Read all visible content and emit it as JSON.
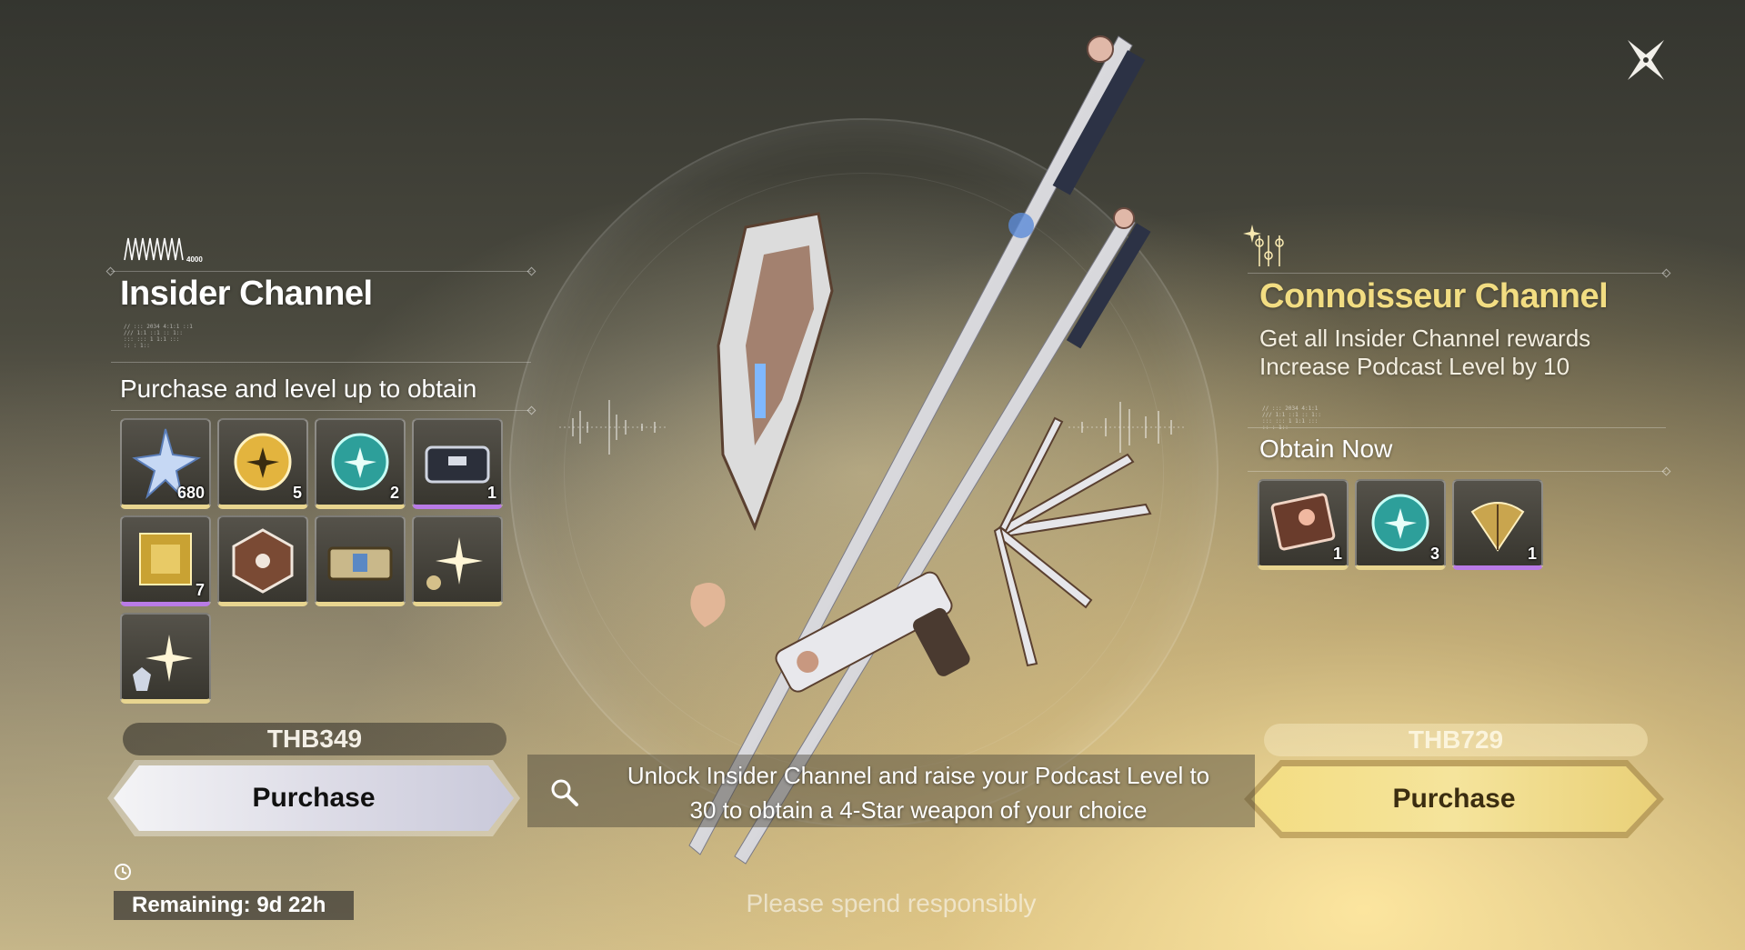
{
  "close_button": {
    "icon": "close-x-icon"
  },
  "insider": {
    "logo_caption": "4000",
    "title": "Insider Channel",
    "subtitle": "Purchase and level up to obtain",
    "items": [
      {
        "icon": "star-crystal-icon",
        "qty": "680",
        "rarity": "gold"
      },
      {
        "icon": "gold-orb-icon",
        "qty": "5",
        "rarity": "gold"
      },
      {
        "icon": "teal-orb-icon",
        "qty": "2",
        "rarity": "gold"
      },
      {
        "icon": "supply-case-icon",
        "qty": "1",
        "rarity": "purple"
      },
      {
        "icon": "gold-cube-icon",
        "qty": "7",
        "rarity": "purple"
      },
      {
        "icon": "dice-icon",
        "qty": "",
        "rarity": "gold"
      },
      {
        "icon": "chest-icon",
        "qty": "",
        "rarity": "gold"
      },
      {
        "icon": "sparkle-emblem-icon",
        "qty": "",
        "rarity": "gold"
      },
      {
        "icon": "wolf-emblem-icon",
        "qty": "",
        "rarity": "gold"
      }
    ],
    "price": "THB349",
    "purchase_label": "Purchase",
    "remaining": "Remaining: 9d 22h"
  },
  "connoisseur": {
    "title": "Connoisseur Channel",
    "desc_line1": "Get all Insider Channel rewards",
    "desc_line2": "Increase Podcast Level by 10",
    "obtain_label": "Obtain Now",
    "items": [
      {
        "icon": "card-icon",
        "qty": "1",
        "rarity": "gold"
      },
      {
        "icon": "teal-orb-icon",
        "qty": "3",
        "rarity": "gold"
      },
      {
        "icon": "ginkgo-fan-icon",
        "qty": "1",
        "rarity": "purple"
      }
    ],
    "price": "THB729",
    "purchase_label": "Purchase"
  },
  "banner": {
    "line1": "Unlock Insider Channel and raise your Podcast Level to",
    "line2": "30 to obtain a 4-Star weapon of your choice"
  },
  "footer": {
    "note": "Please spend responsibly"
  },
  "colors": {
    "gold_accent": "#f2dd82",
    "purple_rarity": "#b97be6",
    "gold_rarity": "#e8d590"
  }
}
